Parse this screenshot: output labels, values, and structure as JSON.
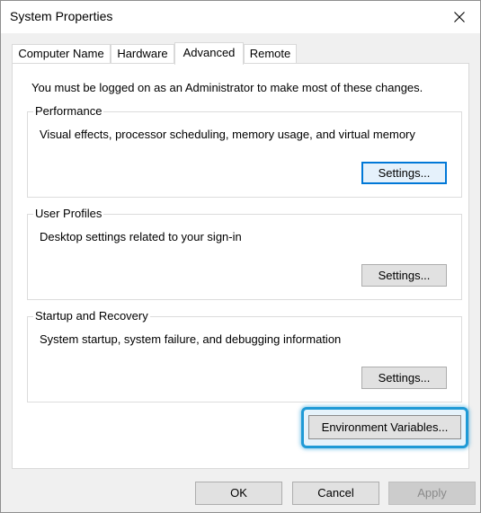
{
  "window": {
    "title": "System Properties"
  },
  "tabs": [
    {
      "label": "Computer Name"
    },
    {
      "label": "Hardware"
    },
    {
      "label": "Advanced"
    },
    {
      "label": "Remote"
    }
  ],
  "active_tab": "Advanced",
  "admin_note": "You must be logged on as an Administrator to make most of these changes.",
  "groups": {
    "performance": {
      "title": "Performance",
      "description": "Visual effects, processor scheduling, memory usage, and virtual memory",
      "button": "Settings..."
    },
    "user_profiles": {
      "title": "User Profiles",
      "description": "Desktop settings related to your sign-in",
      "button": "Settings..."
    },
    "startup_recovery": {
      "title": "Startup and Recovery",
      "description": "System startup, system failure, and debugging information",
      "button": "Settings..."
    }
  },
  "env_button": "Environment Variables...",
  "footer": {
    "ok": "OK",
    "cancel": "Cancel",
    "apply": "Apply"
  },
  "colors": {
    "focus_border": "#0078d7",
    "highlight": "#1f9ad6",
    "dialog_bg": "#f0f0f0"
  },
  "icons": {
    "close": "close-icon"
  }
}
